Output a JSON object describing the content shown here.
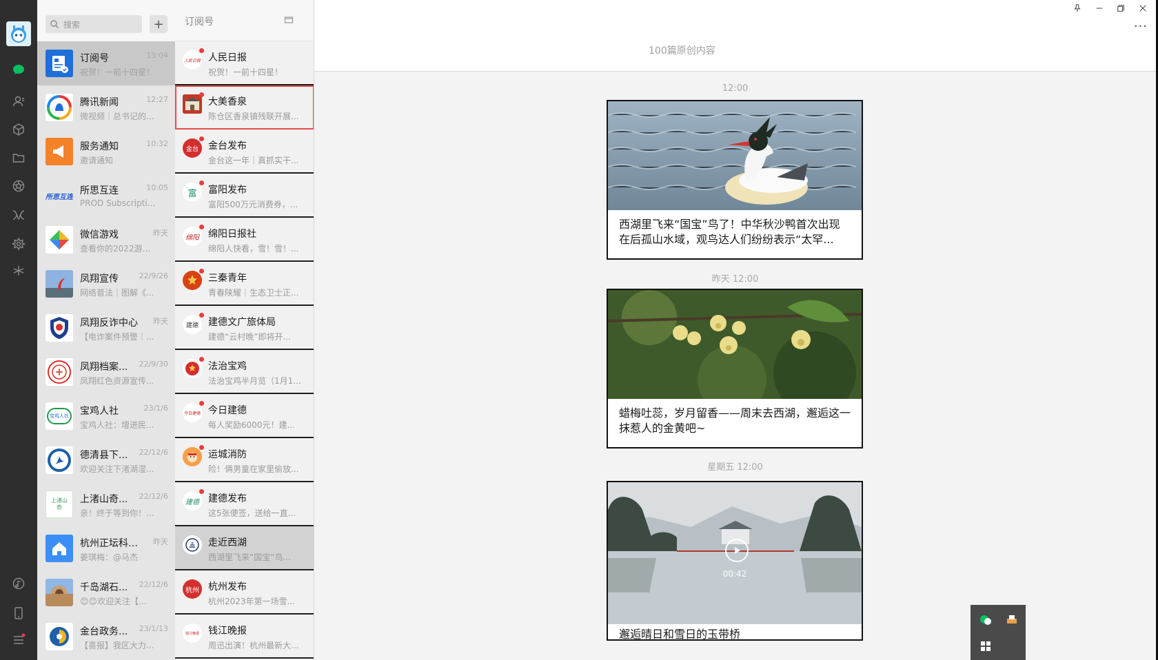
{
  "chatlist": {
    "search_placeholder": "搜索",
    "add_label": "+",
    "items": [
      {
        "name": "订阅号",
        "time": "13:04",
        "preview": "祝贺！一前十四星！"
      },
      {
        "name": "腾讯新闻",
        "time": "12:27",
        "preview": "微视频｜总书记的..."
      },
      {
        "name": "服务通知",
        "time": "10:32",
        "preview": "邀请通知"
      },
      {
        "name": "所思互连",
        "time": "10:05",
        "preview": "PROD Subscripti..."
      },
      {
        "name": "微信游戏",
        "time": "昨天",
        "preview": "查看你的2022游戏..."
      },
      {
        "name": "凤翔宣传",
        "time": "22/9/26",
        "preview": "网络普法｜图解《..."
      },
      {
        "name": "凤翔反诈中心",
        "time": "昨天",
        "preview": "【电诈案件预警｜..."
      },
      {
        "name": "凤翔档案...",
        "time": "22/9/30",
        "preview": "凤翔红色资源宣传..."
      },
      {
        "name": "宝鸡人社",
        "time": "23/1/6",
        "preview": "宝鸡人社：增进民..."
      },
      {
        "name": "德清县下...",
        "time": "22/12/6",
        "preview": "欢迎关注下渚湖湿..."
      },
      {
        "name": "上渚山奇...",
        "time": "22/12/6",
        "preview": "亲！终于等到你！..."
      },
      {
        "name": "杭州正坛科技...",
        "time": "昨天",
        "preview": "姜琪梅：@马杰"
      },
      {
        "name": "千岛湖石...",
        "time": "22/12/6",
        "preview": "😊😊欢迎关注【..."
      },
      {
        "name": "金台政务...",
        "time": "23/1/13",
        "preview": "【喜报】我区大力..."
      }
    ],
    "logo_text": {
      "suosi": "所思互连",
      "baoji": "宝鸡人社",
      "shangzhu": "上渚山奇"
    }
  },
  "subscriptions": {
    "title": "订阅号",
    "items": [
      {
        "name": "人民日报",
        "preview": "祝贺！一前十四星！",
        "logo": "人民日报"
      },
      {
        "name": "大美香泉",
        "preview": "陈仓区香泉镇残联开展...",
        "logo": ""
      },
      {
        "name": "金台发布",
        "preview": "金台这一年｜真抓实干...",
        "logo": "金台"
      },
      {
        "name": "富阳发布",
        "preview": "富阳500万元消费券，...",
        "logo": "富"
      },
      {
        "name": "绵阳日报社",
        "preview": "绵阳人快看，雪！雪！...",
        "logo": "绵阳"
      },
      {
        "name": "三秦青年",
        "preview": "青春陕耀｜生态卫士正...",
        "logo": ""
      },
      {
        "name": "建德文广旅体局",
        "preview": "建德“云村晚”即将开...",
        "logo": "建德"
      },
      {
        "name": "法治宝鸡",
        "preview": "法治宝鸡半月览（1月1...",
        "logo": ""
      },
      {
        "name": "今日建德",
        "preview": "每人奖励6000元！建...",
        "logo": "今日建德"
      },
      {
        "name": "运城消防",
        "preview": "险！俩男童在家里偷放...",
        "logo": ""
      },
      {
        "name": "建德发布",
        "preview": "这5张便签，送给一直...",
        "logo": "建德"
      },
      {
        "name": "走近西湖",
        "preview": "西湖里飞来“国宝”鸟...",
        "logo": ""
      },
      {
        "name": "杭州发布",
        "preview": "杭州2023年第一场雪...",
        "logo": "杭州"
      },
      {
        "name": "钱江晚报",
        "preview": "周迅出演！杭州最新大...",
        "logo": "钱江晚报"
      }
    ]
  },
  "article_pane": {
    "subtitle": "100篇原创内容",
    "more_label": "···",
    "posts": [
      {
        "timestamp": "12:00",
        "title": "西湖里飞来“国宝”鸟了！中华秋沙鸭首次出现在后孤山水域，观鸟达人们纷纷表示“太罕...",
        "image": "merganser-on-water"
      },
      {
        "timestamp": "昨天  12:00",
        "title": "蜡梅吐蕊，岁月留香——周末去西湖，邂逅这一抹惹人的金黄吧~",
        "image": "wintersweet-blossoms"
      },
      {
        "timestamp": "星期五  12:00",
        "title": "邂逅晴日和雪日的玉带桥",
        "image": "lake-pavilion-video",
        "duration": "00:42"
      }
    ]
  },
  "colors": {
    "rail": "#2e2e2e",
    "accent_green": "#07c160",
    "unread_dot": "#e43d3d",
    "selection": "#e84b4b"
  }
}
